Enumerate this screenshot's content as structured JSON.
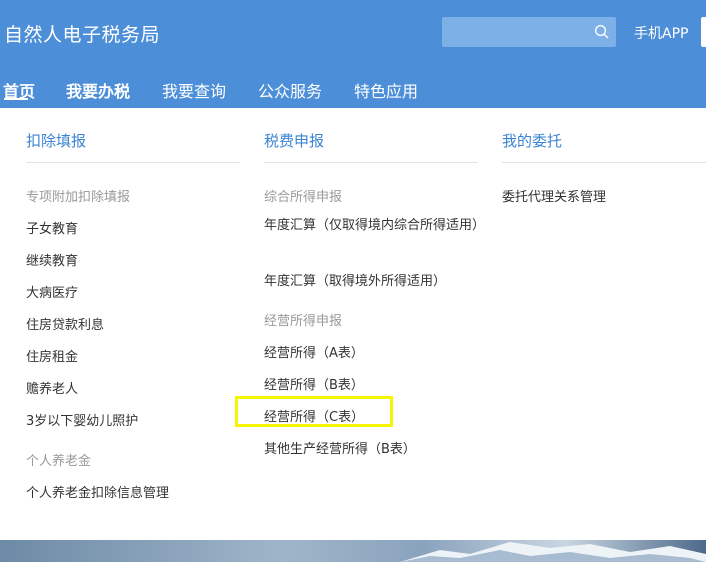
{
  "header": {
    "title": "自然人电子税务局",
    "search": {
      "value": "",
      "placeholder": ""
    },
    "search_icon": "search-icon",
    "app_link": "手机APP"
  },
  "nav": {
    "items": [
      {
        "label": "首页",
        "active": true
      },
      {
        "label": "我要办税",
        "active": false
      },
      {
        "label": "我要查询",
        "active": false
      },
      {
        "label": "公众服务",
        "active": false
      },
      {
        "label": "特色应用",
        "active": false
      }
    ]
  },
  "menu": {
    "columns": [
      {
        "title": "扣除填报",
        "sections": [
          {
            "heading": "专项附加扣除填报",
            "items": [
              "子女教育",
              "继续教育",
              "大病医疗",
              "住房贷款利息",
              "住房租金",
              "赡养老人",
              "3岁以下婴幼儿照护"
            ]
          },
          {
            "heading": "个人养老金",
            "items": [
              "个人养老金扣除信息管理"
            ]
          }
        ]
      },
      {
        "title": "税费申报",
        "sections": [
          {
            "heading": "综合所得申报",
            "items": [
              "年度汇算（仅取得境内综合所得适用）",
              "年度汇算（取得境外所得适用）"
            ]
          },
          {
            "heading": "经营所得申报",
            "items": [
              "经营所得（A表）",
              "经营所得（B表）",
              "经营所得（C表）",
              "其他生产经营所得（B表）"
            ]
          }
        ]
      },
      {
        "title": "我的委托",
        "sections": [
          {
            "heading": "",
            "items": [
              "委托代理关系管理"
            ]
          }
        ]
      }
    ],
    "highlighted_item": "经营所得（C表）"
  },
  "colors": {
    "header_bg": "#4c8fd8",
    "link_blue": "#3b84d4",
    "highlight": "#f6f600",
    "section_gray": "#999999",
    "text": "#333333"
  }
}
